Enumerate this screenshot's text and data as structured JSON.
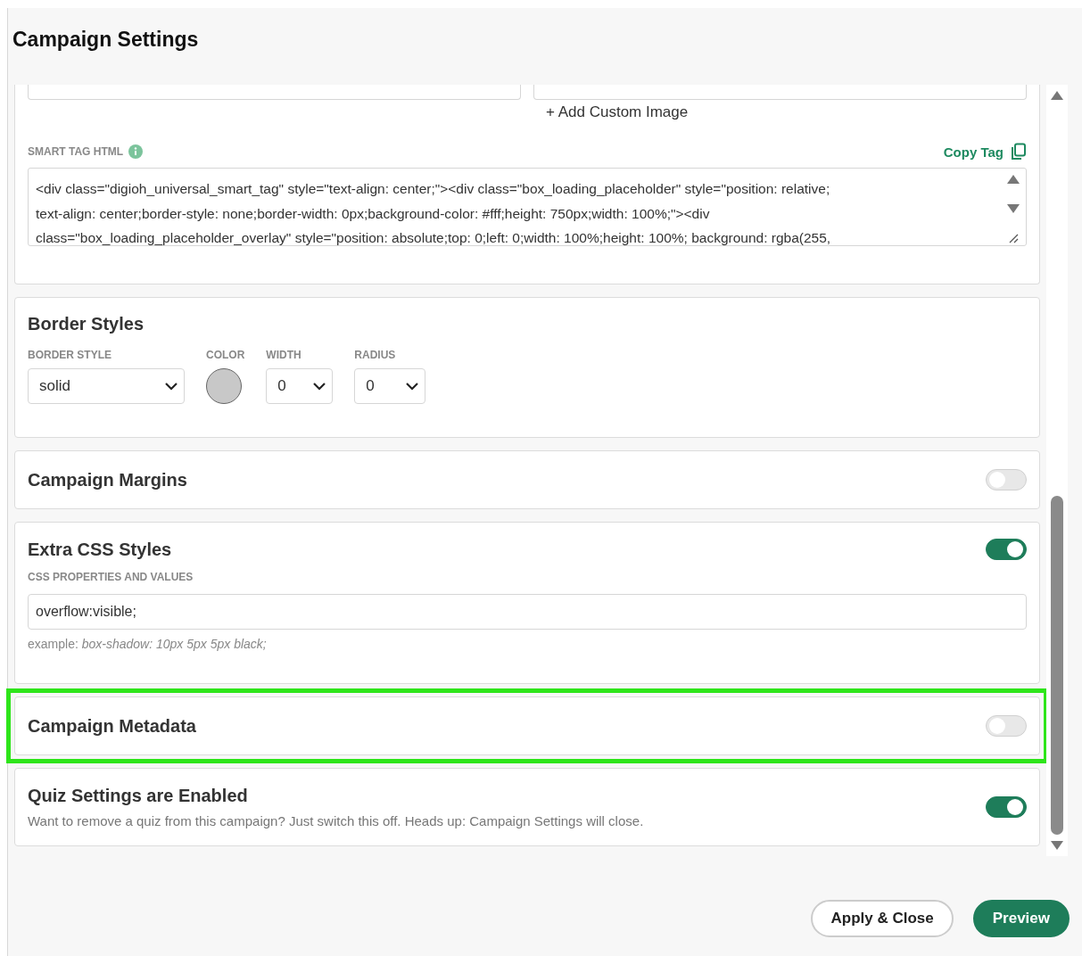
{
  "title": "Campaign Settings",
  "smart_tag_card": {
    "add_image_link": "+ Add Custom Image",
    "html_label": "SMART TAG HTML",
    "copy_button": "Copy Tag",
    "html_lines": [
      "<div class=\"digioh_universal_smart_tag\" style=\"text-align: center;\"><div class=\"box_loading_placeholder\" style=\"position: relative;",
      "text-align: center;border-style: none;border-width: 0px;background-color: #fff;height: 750px;width: 100%;\"><div",
      "class=\"box_loading_placeholder_overlay\" style=\"position: absolute;top: 0;left: 0;width: 100%;height: 100%; background: rgba(255,"
    ]
  },
  "sections": [
    {
      "kind": "border",
      "title": "Border Styles",
      "fields": [
        {
          "kind": "select",
          "label": "BORDER STYLE",
          "value": "solid"
        },
        {
          "kind": "color",
          "label": "COLOR",
          "color": "#c8c8c8"
        },
        {
          "kind": "select",
          "label": "WIDTH",
          "value": "0"
        },
        {
          "kind": "select",
          "label": "RADIUS",
          "value": "0"
        }
      ]
    },
    {
      "kind": "toggle",
      "title": "Campaign Margins",
      "on": false,
      "highlighted": false
    },
    {
      "kind": "css",
      "title": "Extra CSS Styles",
      "on": true,
      "highlighted": false,
      "field_label": "CSS PROPERTIES AND VALUES",
      "value": "overflow:visible;",
      "hint": "example: *box-shadow: 10px 5px 5px black;*"
    },
    {
      "kind": "toggle",
      "title": "Campaign Metadata",
      "on": false,
      "highlighted": true
    },
    {
      "kind": "toggle",
      "title": "Quiz Settings are Enabled",
      "on": true,
      "highlighted": false,
      "description": "Want to remove a quiz from this campaign? Just switch this off. Heads up: Campaign Settings will close."
    }
  ],
  "buttons": [
    {
      "kind": "secondary",
      "label": "Apply & Close"
    },
    {
      "kind": "primary",
      "label": "Preview"
    }
  ]
}
